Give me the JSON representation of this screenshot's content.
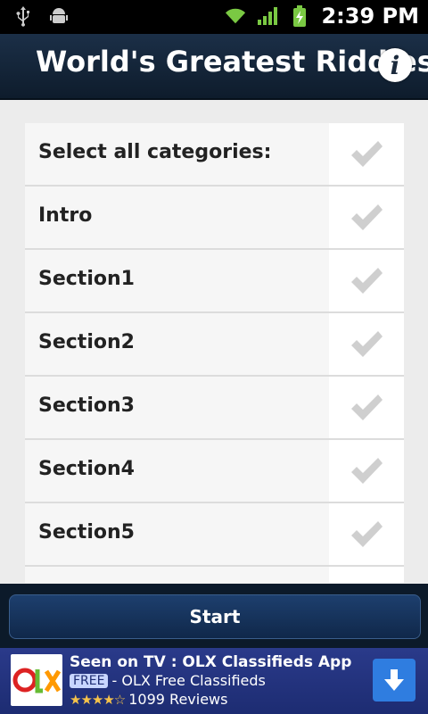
{
  "status_bar": {
    "time": "2:39 PM",
    "icons": [
      "usb-icon",
      "android-debug-icon",
      "wifi-icon",
      "signal-icon",
      "battery-charging-icon"
    ]
  },
  "header": {
    "title": "World's Greatest Riddles",
    "info_icon": "i"
  },
  "categories": [
    {
      "label": "Select all categories:",
      "checked": true
    },
    {
      "label": "Intro",
      "checked": true
    },
    {
      "label": "Section1",
      "checked": true
    },
    {
      "label": "Section2",
      "checked": true
    },
    {
      "label": "Section3",
      "checked": true
    },
    {
      "label": "Section4",
      "checked": true
    },
    {
      "label": "Section5",
      "checked": true
    },
    {
      "label": "",
      "checked": true
    }
  ],
  "start_button": {
    "label": "Start"
  },
  "ad": {
    "title": "Seen on TV : OLX Classifieds App",
    "free_badge": "FREE",
    "subtitle": "- OLX Free Classifieds",
    "rating_stars": 4,
    "reviews": "1099 Reviews",
    "logo_text": "OLX"
  },
  "colors": {
    "header_bg": "#14253a",
    "start_bg": "#1d3f6e",
    "ad_bg": "#2a3a8a",
    "check_color": "#cfcfcf"
  }
}
